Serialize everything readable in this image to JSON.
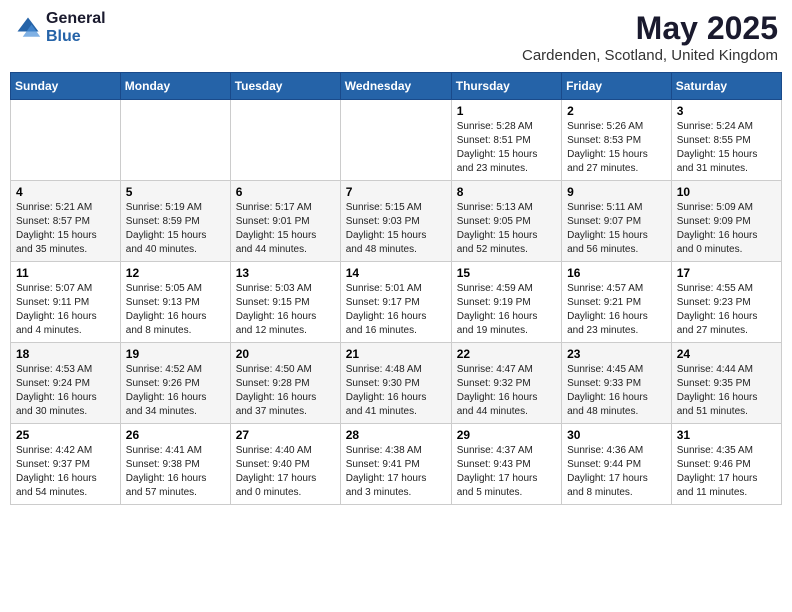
{
  "logo": {
    "general": "General",
    "blue": "Blue"
  },
  "title": "May 2025",
  "location": "Cardenden, Scotland, United Kingdom",
  "days": [
    "Sunday",
    "Monday",
    "Tuesday",
    "Wednesday",
    "Thursday",
    "Friday",
    "Saturday"
  ],
  "weeks": [
    {
      "cells": [
        {
          "day": "",
          "info": ""
        },
        {
          "day": "",
          "info": ""
        },
        {
          "day": "",
          "info": ""
        },
        {
          "day": "",
          "info": ""
        },
        {
          "day": "1",
          "info": "Sunrise: 5:28 AM\nSunset: 8:51 PM\nDaylight: 15 hours\nand 23 minutes."
        },
        {
          "day": "2",
          "info": "Sunrise: 5:26 AM\nSunset: 8:53 PM\nDaylight: 15 hours\nand 27 minutes."
        },
        {
          "day": "3",
          "info": "Sunrise: 5:24 AM\nSunset: 8:55 PM\nDaylight: 15 hours\nand 31 minutes."
        }
      ]
    },
    {
      "cells": [
        {
          "day": "4",
          "info": "Sunrise: 5:21 AM\nSunset: 8:57 PM\nDaylight: 15 hours\nand 35 minutes."
        },
        {
          "day": "5",
          "info": "Sunrise: 5:19 AM\nSunset: 8:59 PM\nDaylight: 15 hours\nand 40 minutes."
        },
        {
          "day": "6",
          "info": "Sunrise: 5:17 AM\nSunset: 9:01 PM\nDaylight: 15 hours\nand 44 minutes."
        },
        {
          "day": "7",
          "info": "Sunrise: 5:15 AM\nSunset: 9:03 PM\nDaylight: 15 hours\nand 48 minutes."
        },
        {
          "day": "8",
          "info": "Sunrise: 5:13 AM\nSunset: 9:05 PM\nDaylight: 15 hours\nand 52 minutes."
        },
        {
          "day": "9",
          "info": "Sunrise: 5:11 AM\nSunset: 9:07 PM\nDaylight: 15 hours\nand 56 minutes."
        },
        {
          "day": "10",
          "info": "Sunrise: 5:09 AM\nSunset: 9:09 PM\nDaylight: 16 hours\nand 0 minutes."
        }
      ]
    },
    {
      "cells": [
        {
          "day": "11",
          "info": "Sunrise: 5:07 AM\nSunset: 9:11 PM\nDaylight: 16 hours\nand 4 minutes."
        },
        {
          "day": "12",
          "info": "Sunrise: 5:05 AM\nSunset: 9:13 PM\nDaylight: 16 hours\nand 8 minutes."
        },
        {
          "day": "13",
          "info": "Sunrise: 5:03 AM\nSunset: 9:15 PM\nDaylight: 16 hours\nand 12 minutes."
        },
        {
          "day": "14",
          "info": "Sunrise: 5:01 AM\nSunset: 9:17 PM\nDaylight: 16 hours\nand 16 minutes."
        },
        {
          "day": "15",
          "info": "Sunrise: 4:59 AM\nSunset: 9:19 PM\nDaylight: 16 hours\nand 19 minutes."
        },
        {
          "day": "16",
          "info": "Sunrise: 4:57 AM\nSunset: 9:21 PM\nDaylight: 16 hours\nand 23 minutes."
        },
        {
          "day": "17",
          "info": "Sunrise: 4:55 AM\nSunset: 9:23 PM\nDaylight: 16 hours\nand 27 minutes."
        }
      ]
    },
    {
      "cells": [
        {
          "day": "18",
          "info": "Sunrise: 4:53 AM\nSunset: 9:24 PM\nDaylight: 16 hours\nand 30 minutes."
        },
        {
          "day": "19",
          "info": "Sunrise: 4:52 AM\nSunset: 9:26 PM\nDaylight: 16 hours\nand 34 minutes."
        },
        {
          "day": "20",
          "info": "Sunrise: 4:50 AM\nSunset: 9:28 PM\nDaylight: 16 hours\nand 37 minutes."
        },
        {
          "day": "21",
          "info": "Sunrise: 4:48 AM\nSunset: 9:30 PM\nDaylight: 16 hours\nand 41 minutes."
        },
        {
          "day": "22",
          "info": "Sunrise: 4:47 AM\nSunset: 9:32 PM\nDaylight: 16 hours\nand 44 minutes."
        },
        {
          "day": "23",
          "info": "Sunrise: 4:45 AM\nSunset: 9:33 PM\nDaylight: 16 hours\nand 48 minutes."
        },
        {
          "day": "24",
          "info": "Sunrise: 4:44 AM\nSunset: 9:35 PM\nDaylight: 16 hours\nand 51 minutes."
        }
      ]
    },
    {
      "cells": [
        {
          "day": "25",
          "info": "Sunrise: 4:42 AM\nSunset: 9:37 PM\nDaylight: 16 hours\nand 54 minutes."
        },
        {
          "day": "26",
          "info": "Sunrise: 4:41 AM\nSunset: 9:38 PM\nDaylight: 16 hours\nand 57 minutes."
        },
        {
          "day": "27",
          "info": "Sunrise: 4:40 AM\nSunset: 9:40 PM\nDaylight: 17 hours\nand 0 minutes."
        },
        {
          "day": "28",
          "info": "Sunrise: 4:38 AM\nSunset: 9:41 PM\nDaylight: 17 hours\nand 3 minutes."
        },
        {
          "day": "29",
          "info": "Sunrise: 4:37 AM\nSunset: 9:43 PM\nDaylight: 17 hours\nand 5 minutes."
        },
        {
          "day": "30",
          "info": "Sunrise: 4:36 AM\nSunset: 9:44 PM\nDaylight: 17 hours\nand 8 minutes."
        },
        {
          "day": "31",
          "info": "Sunrise: 4:35 AM\nSunset: 9:46 PM\nDaylight: 17 hours\nand 11 minutes."
        }
      ]
    }
  ]
}
